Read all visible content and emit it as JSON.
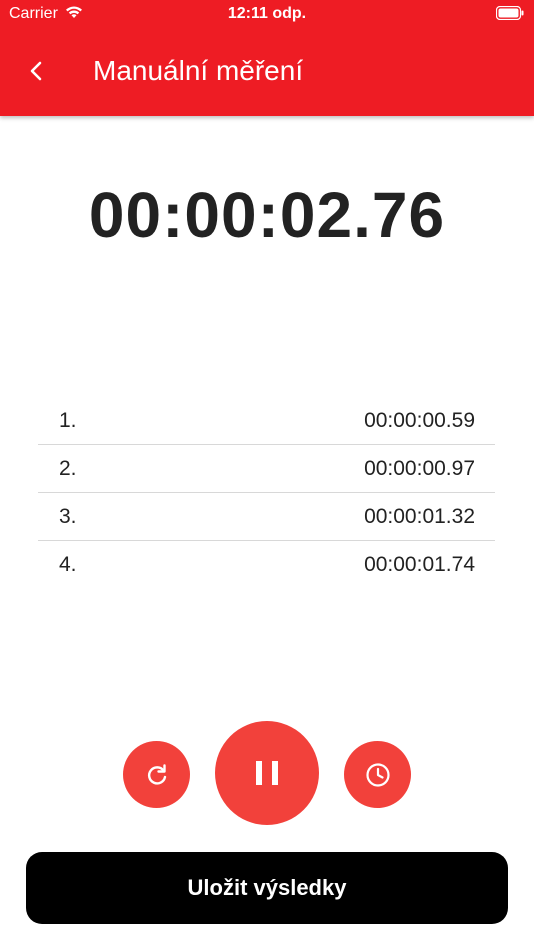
{
  "status_bar": {
    "carrier": "Carrier",
    "time": "12:11 odp."
  },
  "header": {
    "title": "Manuální měření",
    "background_color": "#ee1c24"
  },
  "timer": {
    "display": "00:00:02.76"
  },
  "laps": [
    {
      "index": "1.",
      "time": "00:00:00.59"
    },
    {
      "index": "2.",
      "time": "00:00:00.97"
    },
    {
      "index": "3.",
      "time": "00:00:01.32"
    },
    {
      "index": "4.",
      "time": "00:00:01.74"
    }
  ],
  "controls": {
    "reset_icon": "reset-icon",
    "pause_icon": "pause-icon",
    "lap_icon": "clock-icon",
    "accent_color": "#f2413b"
  },
  "save_button": {
    "label": "Uložit výsledky"
  }
}
